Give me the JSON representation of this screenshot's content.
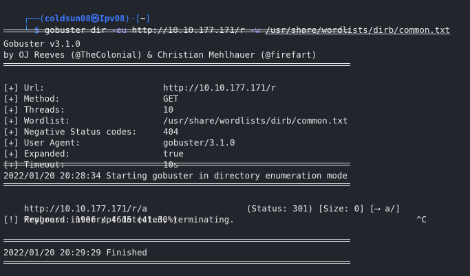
{
  "prompt": {
    "top_prefix": "┌──(",
    "user": "coldsun08",
    "at_symbol": "㉿",
    "host": "Ipv08",
    "top_mid": ")-[",
    "cwd": "~",
    "top_suffix": "]",
    "bottom_prefix": "└─",
    "dollar": "$",
    "command": "gobuster",
    "subcommand": "dir",
    "flag_eu": "-eu",
    "url": "http://10.10.177.171/r",
    "flag_w": "-w",
    "wordlist": "/usr/share/wordlists/dirb/common.txt"
  },
  "banner": {
    "version": "Gobuster v3.1.0",
    "authors": "by OJ Reeves (@TheColonial) & Christian Mehlhauer (@firefart)"
  },
  "config": [
    {
      "label": "[+] Url:",
      "value": "http://10.10.177.171/r"
    },
    {
      "label": "[+] Method:",
      "value": "GET"
    },
    {
      "label": "[+] Threads:",
      "value": "10"
    },
    {
      "label": "[+] Wordlist:",
      "value": "/usr/share/wordlists/dirb/common.txt"
    },
    {
      "label": "[+] Negative Status codes:",
      "value": "404"
    },
    {
      "label": "[+] User Agent:",
      "value": "gobuster/3.1.0"
    },
    {
      "label": "[+] Expanded:",
      "value": "true"
    },
    {
      "label": "[+] Timeout:",
      "value": "10s"
    }
  ],
  "start_line": "2022/01/20 20:28:34 Starting gobuster in directory enumeration mode",
  "result": {
    "url": "http://10.10.177.171/r/a",
    "status": "(Status: 301) [Size: 0] [⟶ a/]"
  },
  "progress": {
    "text": "Progress: 1906 / 4615 (41.30%)",
    "ctrl_c": "^C"
  },
  "interrupt": "[!] Keyboard interrupt detected, terminating.",
  "finished": "2022/01/20 20:29:29 Finished",
  "colors": {
    "background": "#23252c",
    "text": "#e6e6e6",
    "prompt_blue": "#2f8bff",
    "flag_purple": "#7d8cff"
  }
}
